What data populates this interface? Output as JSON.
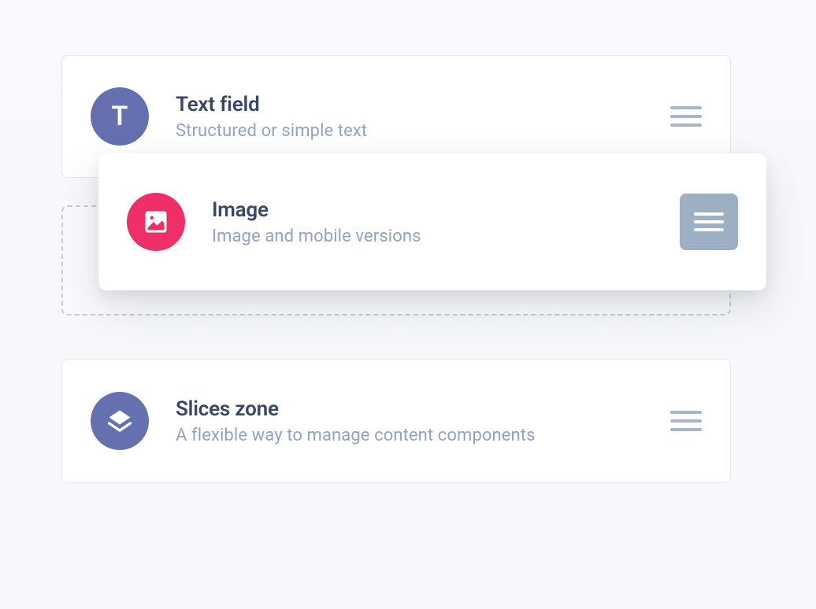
{
  "fields": {
    "textField": {
      "iconLetter": "T",
      "title": "Text field",
      "subtitle": "Structured or simple text"
    },
    "image": {
      "title": "Image",
      "subtitle": "Image and mobile versions"
    },
    "slicesZone": {
      "title": "Slices zone",
      "subtitle": "A flexible way to manage content components"
    }
  }
}
